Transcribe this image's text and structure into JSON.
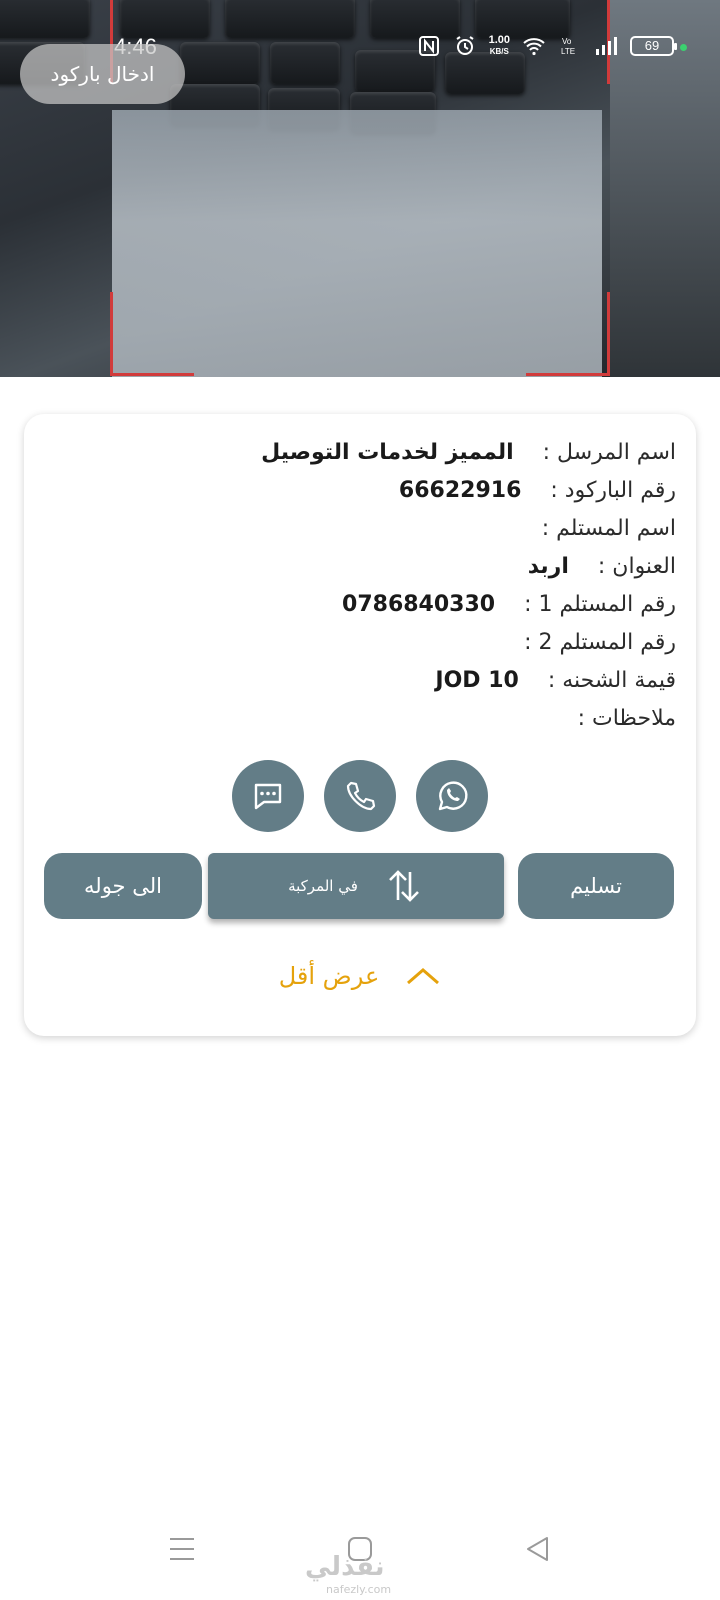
{
  "status": {
    "time": "4:46",
    "speed_value": "1.00",
    "speed_unit": "KB/S",
    "battery": "69"
  },
  "barcode_button": "ادخال باركود",
  "shipment": {
    "sender_label": "اسم المرسل :",
    "sender_value": "المميز لخدمات التوصيل",
    "barcode_label": "رقم الباركود :",
    "barcode_value": "66622916",
    "recipient_label": "اسم المستلم :",
    "recipient_value": "",
    "address_label": "العنوان :",
    "address_value": "اربد",
    "phone1_label": "رقم المستلم 1 :",
    "phone1_value": "0786840330",
    "phone2_label": "رقم المستلم 2 :",
    "phone2_value": "",
    "amount_label": "قيمة الشحنه :",
    "amount_value": "JOD 10",
    "notes_label": "ملاحظات :",
    "notes_value": ""
  },
  "actions": {
    "deliver": "تسليم",
    "in_vehicle": "في المركبة",
    "to_tour": "الى جوله",
    "show_less": "عرض أقل"
  },
  "watermark": {
    "text": "نفذلي",
    "sub": "nafezly.com"
  },
  "colors": {
    "accent": "#637d87",
    "link": "#e5a20c",
    "frame": "#d13b3b"
  }
}
